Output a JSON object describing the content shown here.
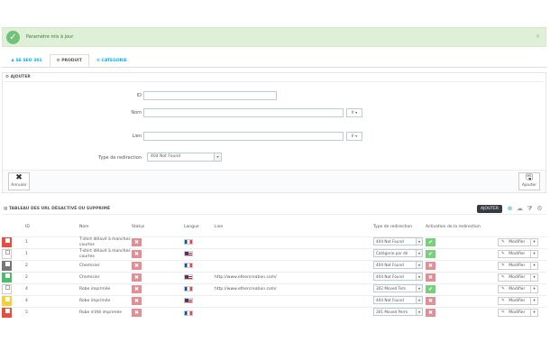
{
  "notification": {
    "message": "Paramètre mis à jour",
    "close": "×"
  },
  "tabs": [
    {
      "label": "SE SEO 301",
      "icon": "person-icon"
    },
    {
      "label": "PRODUIT",
      "icon": "gears-icon"
    },
    {
      "label": "CATEGORIE",
      "icon": "gears-icon"
    }
  ],
  "form": {
    "title": "AJOUTER",
    "id_label": "ID",
    "id_value": "",
    "name_label": "Nom",
    "name_value": "",
    "link_label": "Lien",
    "link_value": "",
    "lang_button": "fr",
    "redirect_label": "Type de redirection",
    "redirect_value": "404 Not Found",
    "cancel_label": "Annuler",
    "add_label": "Ajouter"
  },
  "table": {
    "title": "TABLEAU DES URL DÉSACTIVÉ OU SUPPRIMÉ",
    "add_tooltip": "AJOUTER",
    "columns": {
      "id": "ID",
      "name": "Nom",
      "status": "Status",
      "lang": "Langue",
      "link": "Lien",
      "redirect": "Type de redirection",
      "activation": "Activation de la redirection"
    },
    "edit_label": "Modifier",
    "rows": [
      {
        "id": "1",
        "name": "T-shirt délavé à manches courtes",
        "lang": "fr",
        "link": "",
        "redirect": "404 Not Found",
        "activation": "ok",
        "color": "red"
      },
      {
        "id": "1",
        "name": "T-shirt délavé à manches courtes",
        "lang": "en",
        "link": "",
        "redirect": "Catégorie par dé",
        "activation": "ok",
        "color": "white"
      },
      {
        "id": "2",
        "name": "Chemisier",
        "lang": "fr",
        "link": "",
        "redirect": "404 Not Found",
        "activation": "off",
        "color": "gray"
      },
      {
        "id": "2",
        "name": "Chemisier",
        "lang": "en",
        "link": "http://www.ethercreation.com/",
        "redirect": "404 Not Found",
        "activation": "off",
        "color": "green"
      },
      {
        "id": "4",
        "name": "Robe imprimée",
        "lang": "fr",
        "link": "http://www.ethercreation.com/",
        "redirect": "302 Moved Tem",
        "activation": "ok",
        "color": "white"
      },
      {
        "id": "4",
        "name": "Robe imprimée",
        "lang": "en",
        "link": "",
        "redirect": "404 Not Found",
        "activation": "off",
        "color": "yellow"
      },
      {
        "id": "5",
        "name": "Robe d'été imprimée",
        "lang": "fr",
        "link": "",
        "redirect": "301 Moved Perm",
        "activation": "off",
        "color": "red"
      }
    ]
  }
}
